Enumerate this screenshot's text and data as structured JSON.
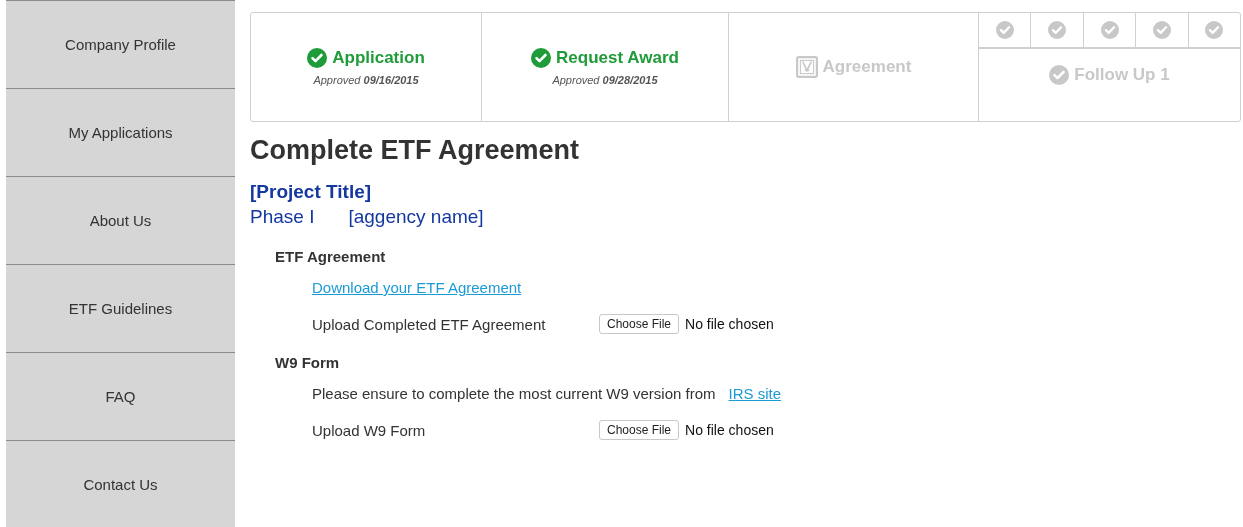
{
  "sidebar": {
    "items": [
      {
        "label": "Company Profile",
        "selected": false
      },
      {
        "label": "My Applications",
        "selected": false
      },
      {
        "label": "About Us",
        "selected": false
      },
      {
        "label": "ETF Guidelines",
        "selected": false
      },
      {
        "label": "FAQ",
        "selected": false
      },
      {
        "label": "Contact Us",
        "selected": false
      }
    ]
  },
  "steps": [
    {
      "kind": "done",
      "label": "Application",
      "note": "Approved **09/16/2015**"
    },
    {
      "kind": "done",
      "label": "Request Award",
      "note": "Approved **09/28/2015**"
    },
    {
      "kind": "pending",
      "label": "Agreement"
    },
    {
      "kind": "followup",
      "label": "Follow Up 1",
      "done": false,
      "checkpoints": [
        {
          "done": false
        },
        {
          "done": false
        },
        {
          "done": false
        },
        {
          "done": false
        },
        {
          "done": false
        }
      ]
    }
  ],
  "page_title": "Complete ETF Agreement",
  "project_title": "[Project Title]",
  "phase": "Phase I",
  "agency": "[aggency name]",
  "sections": [
    {
      "heading": "ETF Agreement",
      "rows": [
        {
          "kind": "link",
          "link": "Download your ETF Agreement"
        },
        {
          "kind": "upload",
          "label": "Upload Completed ETF Agreement",
          "button": "Choose File",
          "status": "No file chosen"
        }
      ]
    },
    {
      "heading": "W9 Form",
      "rows": [
        {
          "kind": "note",
          "text": "Please ensure to complete the most current W9 version from",
          "link": "IRS site"
        },
        {
          "kind": "upload",
          "label": "Upload W9 Form",
          "button": "Choose File",
          "status": "No file chosen"
        }
      ]
    }
  ]
}
